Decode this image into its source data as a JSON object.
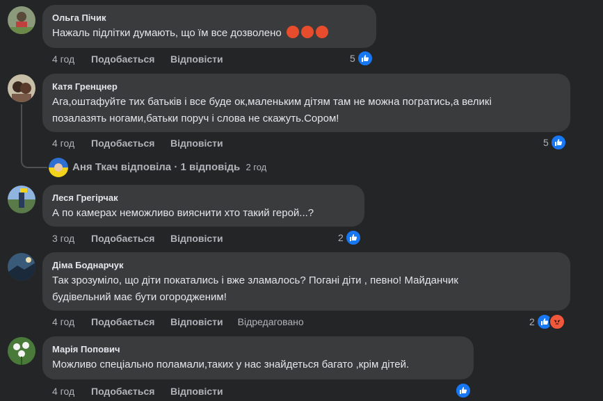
{
  "comments": [
    {
      "author": "Ольга Пічик",
      "lines": [
        "Нажаль підлітки думають, що їм все дозволено"
      ],
      "time": "4 год",
      "like_label": "Подобається",
      "reply_label": "Відповісти",
      "reaction_count": "5"
    },
    {
      "author": "Катя Гренцнер",
      "lines": [
        "Ага,оштафуйте тих батьків і все буде ок,маленьким дітям там не можна погратись,а великі",
        "позалазять ногами,батьки поруч і слова не скажуть.Сором!"
      ],
      "time": "4 год",
      "like_label": "Подобається",
      "reply_label": "Відповісти",
      "reaction_count": "5"
    },
    {
      "author": "Леся Грегірчак",
      "lines": [
        "А по камерах неможливо вияснити хто такий герой...?"
      ],
      "time": "3 год",
      "like_label": "Подобається",
      "reply_label": "Відповісти",
      "reaction_count": "2"
    },
    {
      "author": "Діма Боднарчук",
      "lines": [
        "Так зрозуміло, що діти покатались і вже зламалось? Погані діти , певно! Майданчик",
        "будівельний має бути огородженим!"
      ],
      "time": "4 год",
      "like_label": "Подобається",
      "reply_label": "Відповісти",
      "edited_label": "Відредаговано",
      "reaction_count": "2"
    },
    {
      "author": "Марія Попович",
      "lines": [
        "Можливо спеціально поламали,таких у нас знайдеться багато ,крім дітей."
      ],
      "time": "4 год",
      "like_label": "Подобається",
      "reply_label": "Відповісти",
      "reaction_count": ""
    }
  ],
  "reply_thread": {
    "text": "Аня Ткач відповіла · 1 відповідь",
    "time": "2 год"
  },
  "colors": {
    "background": "#242526",
    "bubble": "#3a3b3c",
    "like": "#1877f2",
    "angry": "#f0573b"
  },
  "icons": {
    "like": "thumbs-up-icon",
    "angry": "angry-face-icon",
    "emoji": "angry-face-emoji"
  }
}
